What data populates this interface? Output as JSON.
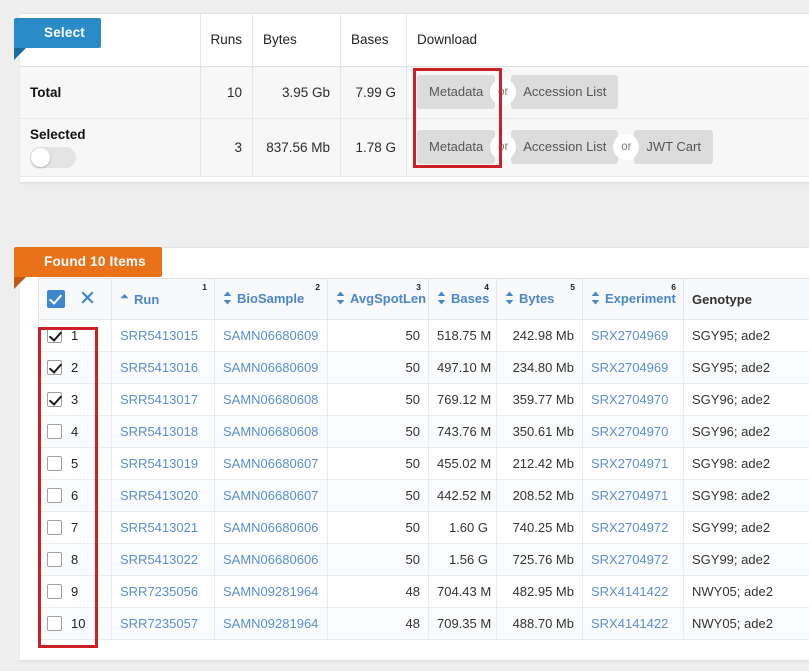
{
  "select_panel": {
    "ribbon_label": "Select",
    "columns": [
      "",
      "Runs",
      "Bytes",
      "Bases",
      "Download"
    ],
    "rows": [
      {
        "label": "Total",
        "runs": "10",
        "bytes": "3.95 Gb",
        "bases": "7.99 G",
        "download_buttons": [
          "Metadata",
          "Accession List"
        ],
        "separator": "or",
        "has_toggle": false
      },
      {
        "label": "Selected",
        "runs": "3",
        "bytes": "837.56 Mb",
        "bases": "1.78 G",
        "download_buttons": [
          "Metadata",
          "Accession List",
          "JWT Cart"
        ],
        "separator": "or",
        "has_toggle": true,
        "toggle_state": "off"
      }
    ]
  },
  "results_panel": {
    "ribbon_label": "Found 10 Items",
    "header": {
      "select_all_icon": "checkbox-checked-icon",
      "clear_icon": "x-clear-icon",
      "columns": [
        {
          "label": "Run",
          "sort": "asc",
          "num": "1",
          "link": true
        },
        {
          "label": "BioSample",
          "sort": "none",
          "num": "2",
          "link": true
        },
        {
          "label": "AvgSpotLen",
          "sort": "none",
          "num": "3",
          "link": true
        },
        {
          "label": "Bases",
          "sort": "none",
          "num": "4",
          "link": true
        },
        {
          "label": "Bytes",
          "sort": "none",
          "num": "5",
          "link": true
        },
        {
          "label": "Experiment",
          "sort": "none",
          "num": "6",
          "link": true
        },
        {
          "label": "Genotype",
          "sort": "none",
          "num": "",
          "link": false
        }
      ]
    },
    "rows": [
      {
        "n": "1",
        "checked": true,
        "run": "SRR5413015",
        "biosample": "SAMN06680609",
        "avgspotlen": "50",
        "bases": "518.75 M",
        "bytes": "242.98 Mb",
        "experiment": "SRX2704969",
        "genotype": "SGY95; ade2"
      },
      {
        "n": "2",
        "checked": true,
        "run": "SRR5413016",
        "biosample": "SAMN06680609",
        "avgspotlen": "50",
        "bases": "497.10 M",
        "bytes": "234.80 Mb",
        "experiment": "SRX2704969",
        "genotype": "SGY95; ade2"
      },
      {
        "n": "3",
        "checked": true,
        "run": "SRR5413017",
        "biosample": "SAMN06680608",
        "avgspotlen": "50",
        "bases": "769.12 M",
        "bytes": "359.77 Mb",
        "experiment": "SRX2704970",
        "genotype": "SGY96; ade2"
      },
      {
        "n": "4",
        "checked": false,
        "run": "SRR5413018",
        "biosample": "SAMN06680608",
        "avgspotlen": "50",
        "bases": "743.76 M",
        "bytes": "350.61 Mb",
        "experiment": "SRX2704970",
        "genotype": "SGY96; ade2"
      },
      {
        "n": "5",
        "checked": false,
        "run": "SRR5413019",
        "biosample": "SAMN06680607",
        "avgspotlen": "50",
        "bases": "455.02 M",
        "bytes": "212.42 Mb",
        "experiment": "SRX2704971",
        "genotype": "SGY98: ade2"
      },
      {
        "n": "6",
        "checked": false,
        "run": "SRR5413020",
        "biosample": "SAMN06680607",
        "avgspotlen": "50",
        "bases": "442.52 M",
        "bytes": "208.52 Mb",
        "experiment": "SRX2704971",
        "genotype": "SGY98: ade2"
      },
      {
        "n": "7",
        "checked": false,
        "run": "SRR5413021",
        "biosample": "SAMN06680606",
        "avgspotlen": "50",
        "bases": "1.60 G",
        "bytes": "740.25 Mb",
        "experiment": "SRX2704972",
        "genotype": "SGY99; ade2"
      },
      {
        "n": "8",
        "checked": false,
        "run": "SRR5413022",
        "biosample": "SAMN06680606",
        "avgspotlen": "50",
        "bases": "1.56 G",
        "bytes": "725.76 Mb",
        "experiment": "SRX2704972",
        "genotype": "SGY99; ade2"
      },
      {
        "n": "9",
        "checked": false,
        "run": "SRR7235056",
        "biosample": "SAMN09281964",
        "avgspotlen": "48",
        "bases": "704.43 M",
        "bytes": "482.95 Mb",
        "experiment": "SRX4141422",
        "genotype": "NWY05; ade2"
      },
      {
        "n": "10",
        "checked": false,
        "run": "SRR7235057",
        "biosample": "SAMN09281964",
        "avgspotlen": "48",
        "bases": "709.35 M",
        "bytes": "488.70 Mb",
        "experiment": "SRX4141422",
        "genotype": "NWY05; ade2"
      }
    ]
  },
  "annotations": [
    {
      "name": "metadata-buttons-highlight",
      "color": "#cc2027"
    },
    {
      "name": "row-checkbox-column-highlight",
      "color": "#cc2027"
    }
  ],
  "colors": {
    "ribbon_select": "#2a8bc9",
    "ribbon_found": "#e8711a",
    "link": "#5b8fce",
    "header_text": "#4a87c7",
    "annotation": "#cc2027"
  }
}
